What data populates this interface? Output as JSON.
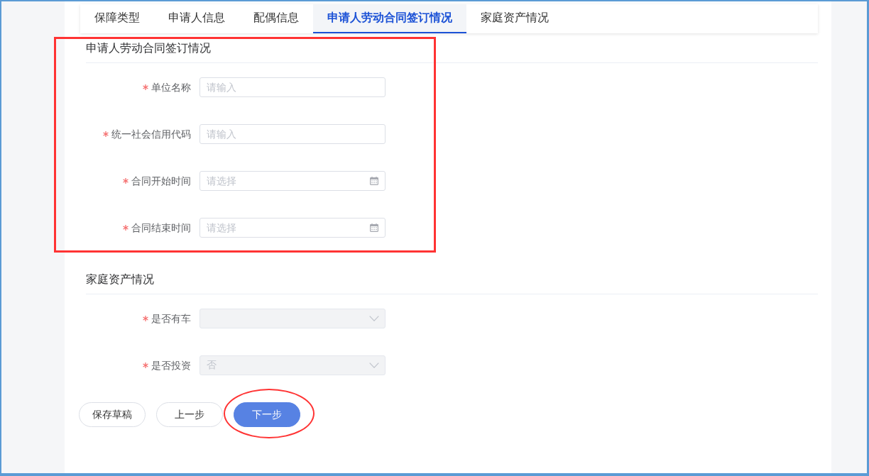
{
  "tabs": [
    {
      "label": "保障类型",
      "selected": false
    },
    {
      "label": "申请人信息",
      "selected": false
    },
    {
      "label": "配偶信息",
      "selected": false
    },
    {
      "label": "申请人劳动合同签订情况",
      "selected": true
    },
    {
      "label": "家庭资产情况",
      "selected": false
    }
  ],
  "sections": [
    {
      "title": "申请人劳动合同签订情况",
      "highlighted": true,
      "fields": [
        {
          "label": "单位名称",
          "kind": "text",
          "required": true,
          "disabled": false,
          "placeholder": "请输入"
        },
        {
          "label": "统一社会信用代码",
          "kind": "text",
          "required": true,
          "disabled": false,
          "placeholder": "请输入"
        },
        {
          "label": "合同开始时间",
          "kind": "date",
          "required": true,
          "disabled": false,
          "placeholder": "请选择"
        },
        {
          "label": "合同结束时间",
          "kind": "date",
          "required": true,
          "disabled": false,
          "placeholder": "请选择"
        }
      ]
    },
    {
      "title": "家庭资产情况",
      "highlighted": false,
      "fields": [
        {
          "label": "是否有车",
          "kind": "select",
          "required": true,
          "disabled": true
        },
        {
          "label": "是否投资",
          "kind": "select",
          "required": true,
          "disabled": true,
          "value": "否"
        }
      ]
    }
  ],
  "buttons": [
    {
      "label": "保存草稿",
      "kind": "default",
      "highlighted": false
    },
    {
      "label": "上一步",
      "kind": "default",
      "highlighted": false
    },
    {
      "label": "下一步",
      "kind": "primary",
      "highlighted": true
    }
  ]
}
